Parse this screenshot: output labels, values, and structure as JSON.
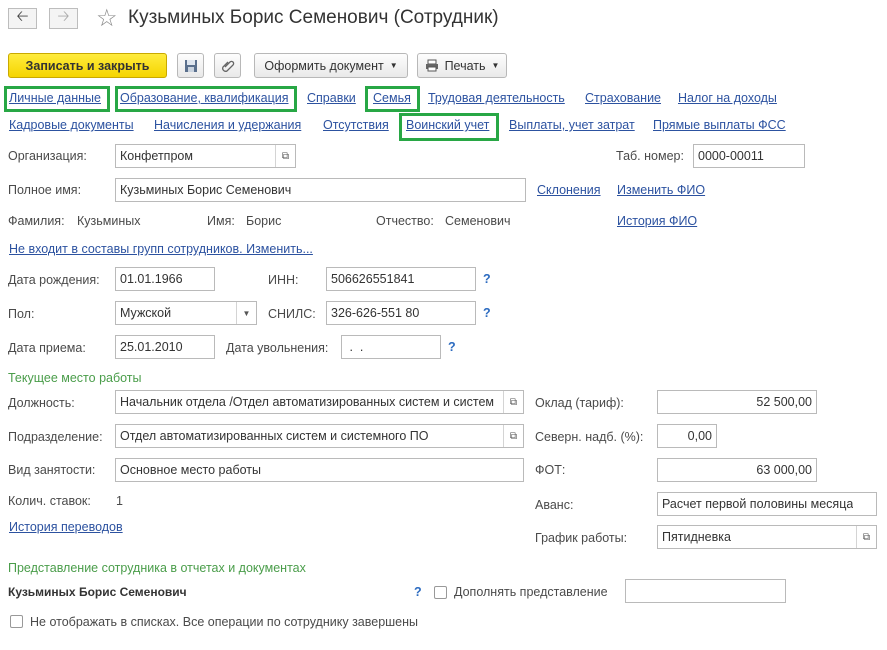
{
  "window": {
    "title": "Кузьминых Борис Семенович (Сотрудник)",
    "back_icon": "arrow-left-icon",
    "forward_icon": "arrow-right-icon",
    "favorite_icon": "star-icon"
  },
  "toolbar": {
    "save_close": "Записать и закрыть",
    "save_icon": "floppy-disk-icon",
    "attach_icon": "paperclip-icon",
    "create_doc": "Оформить документ",
    "print": "Печать",
    "print_icon": "printer-icon"
  },
  "tabs_row1": [
    "Личные данные",
    "Образование, квалификация",
    "Справки",
    "Семья",
    "Трудовая деятельность",
    "Страхование",
    "Налог на доходы"
  ],
  "tabs_row2": [
    "Кадровые документы",
    "Начисления и удержания",
    "Отсутствия",
    "Воинский учет",
    "Выплаты, учет затрат",
    "Прямые выплаты ФСС"
  ],
  "form": {
    "org_label": "Организация:",
    "org_value": "Конфетпром",
    "tab_no_label": "Таб. номер:",
    "tab_no_value": "0000-00011",
    "fullname_label": "Полное имя:",
    "fullname_value": "Кузьминых Борис Семенович",
    "declensions_link": "Склонения",
    "change_fio_link": "Изменить ФИО",
    "lastname_label": "Фамилия:",
    "lastname_value": "Кузьминых",
    "firstname_label": "Имя:",
    "firstname_value": "Борис",
    "patronymic_label": "Отчество:",
    "patronymic_value": "Семенович",
    "history_fio_link": "История ФИО",
    "groups_link": "Не входит в составы групп сотрудников. Изменить...",
    "birth_label": "Дата рождения:",
    "birth_value": "01.01.1966",
    "inn_label": "ИНН:",
    "inn_value": "506626551841",
    "gender_label": "Пол:",
    "gender_value": "Мужской",
    "snils_label": "СНИЛС:",
    "snils_value": "326-626-551 80",
    "hire_label": "Дата приема:",
    "hire_value": "25.01.2010",
    "dismiss_label": "Дата увольнения:",
    "dismiss_value": " .  .",
    "help": "?"
  },
  "workplace": {
    "section_title": "Текущее место работы",
    "position_label": "Должность:",
    "position_value": "Начальник отдела /Отдел автоматизированных систем и систем",
    "salary_label": "Оклад (тариф):",
    "salary_value": "52 500,00",
    "dept_label": "Подразделение:",
    "dept_value": "Отдел автоматизированных систем и системного ПО",
    "north_label": "Северн. надб. (%):",
    "north_value": "0,00",
    "employment_label": "Вид занятости:",
    "employment_value": "Основное место работы",
    "fot_label": "ФОТ:",
    "fot_value": "63 000,00",
    "rates_label": "Колич. ставок:",
    "rates_value": "1",
    "advance_label": "Аванс:",
    "advance_value": "Расчет первой половины месяца",
    "transfers_link": "История переводов",
    "schedule_label": "График работы:",
    "schedule_value": "Пятидневка"
  },
  "representation": {
    "section_title": "Представление сотрудника в отчетах и документах",
    "name": "Кузьминых Борис Семенович",
    "supplement_label": "Дополнять представление",
    "supplement_value": "",
    "hide_label": "Не отображать в списках. Все операции по сотруднику завершены"
  },
  "colors": {
    "highlight": "#28a745",
    "link": "#2c52a0",
    "section": "#4a9d4a",
    "primary_button": "#f5d500"
  }
}
